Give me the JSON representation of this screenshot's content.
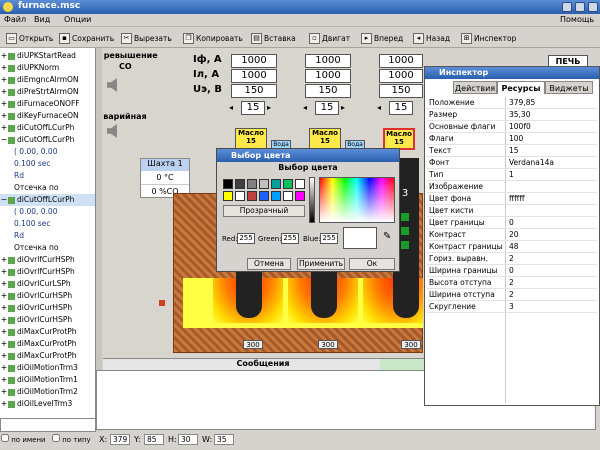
{
  "window": {
    "title": "furnace.msc"
  },
  "menu": {
    "file": "Файл",
    "view": "Вид",
    "options": "Опции",
    "help": "Помощь"
  },
  "toolbar": {
    "open": "Открыть",
    "save": "Сохранить",
    "cut": "Вырезать",
    "copy": "Копировать",
    "paste": "Вставка",
    "move": "Двигат",
    "forward": "Вперед",
    "back": "Назад",
    "inspector": "Инспектор"
  },
  "tree": {
    "items": [
      "diUPKStartRead",
      "diUPKNorm",
      "diEmgncAlrmON",
      "diPreStrtAlrmON",
      "diFurnaceONOFF",
      "diKeyFurnaceON",
      "diCutOffLCurPh",
      "diCutOffLCurPh",
      "( 0.00, 0.00",
      "0.100 sec",
      "Rd",
      "Отсечка по",
      "diCutOffLCurPh",
      "( 0.00, 0.00",
      "0.100 sec",
      "Rd",
      "Отсечка по",
      "diOvrlfCurHSPh",
      "diOvrlfCurHSPh",
      "diOvrlCurLSPh",
      "diOvrlCurHSPh",
      "diOvrlCurHSPh",
      "diOvrlCurHSPh",
      "diMaxCurProtPh",
      "diMaxCurProtPh",
      "diMaxCurProtPh",
      "diOilMotionTrm3",
      "diOilMotionTrm1",
      "diOilMotionTrm2",
      "diOilLevelTrm3"
    ],
    "filter_by_name": "по имени",
    "filter_by_type": "по типу"
  },
  "canvas": {
    "overvoltage_label": "Превышение",
    "co_label": "CO",
    "emergency_label": "Аварийная",
    "rows": [
      {
        "label": "Iф, А",
        "values": [
          "1000",
          "1000",
          "1000"
        ]
      },
      {
        "label": "Iл, А",
        "values": [
          "1000",
          "1000",
          "1000"
        ]
      },
      {
        "label": "Uэ, В",
        "values": [
          "150",
          "150",
          "150"
        ]
      }
    ],
    "stepper_value": "15",
    "oil_label": "Масло",
    "oil_value": "15",
    "water_label": "Вода",
    "shaft_title": "Шахта 1",
    "shaft_temp": "0 °C",
    "shaft_co": "0 %CO",
    "furnace_tags": [
      "300",
      "300",
      "300"
    ],
    "right_stepper": "3",
    "print_button": "ПЕЧЬ"
  },
  "dialog": {
    "title": "Выбор цвета",
    "heading": "Выбор цвета",
    "transparent": "Прозрачный",
    "red_label": "Red:",
    "red_value": "255",
    "green_label": "Green:",
    "green_value": "255",
    "blue_label": "Blue:",
    "blue_value": "255",
    "cancel": "Отмена",
    "apply": "Применить",
    "ok": "Ок",
    "swatches": [
      "#000000",
      "#404040",
      "#808080",
      "#c0c0c0",
      "#00a0a0",
      "#00c060",
      "#ffffff",
      "#ffff00",
      "#ffffff",
      "#c04040",
      "#2060ff",
      "#00a0ff",
      "#ffffff",
      "#ff00ff"
    ]
  },
  "inspector": {
    "title": "Инспектор",
    "tabs": [
      "Действия",
      "Ресурсы",
      "Виджеты"
    ],
    "props": [
      {
        "k": "Положение",
        "v": "379,85"
      },
      {
        "k": "Размер",
        "v": "35,30"
      },
      {
        "k": "Основные флаги",
        "v": "100f0"
      },
      {
        "k": "Флаги",
        "v": "100"
      },
      {
        "k": "Текст",
        "v": "15"
      },
      {
        "k": "Фонт",
        "v": "Verdana14a"
      },
      {
        "k": "Тип",
        "v": "1"
      },
      {
        "k": "Изображение",
        "v": ""
      },
      {
        "k": "Цвет фона",
        "v": "ffffff"
      },
      {
        "k": "Цвет кисти",
        "v": ""
      },
      {
        "k": "Цвет границы",
        "v": "0"
      },
      {
        "k": "Контраст",
        "v": "20"
      },
      {
        "k": "Контраст границы",
        "v": "48"
      },
      {
        "k": "Гориз. выравн.",
        "v": "2"
      },
      {
        "k": "Ширина границы",
        "v": "0"
      },
      {
        "k": "Высота отступа",
        "v": "2"
      },
      {
        "k": "Ширина отступа",
        "v": "2"
      },
      {
        "k": "Скругление",
        "v": "3"
      }
    ]
  },
  "messages": {
    "title": "Сообщения"
  },
  "status": {
    "x_label": "X:",
    "x": "379",
    "y_label": "Y:",
    "y": "85",
    "h_label": "H:",
    "h": "30",
    "w_label": "W:",
    "w": "35"
  }
}
